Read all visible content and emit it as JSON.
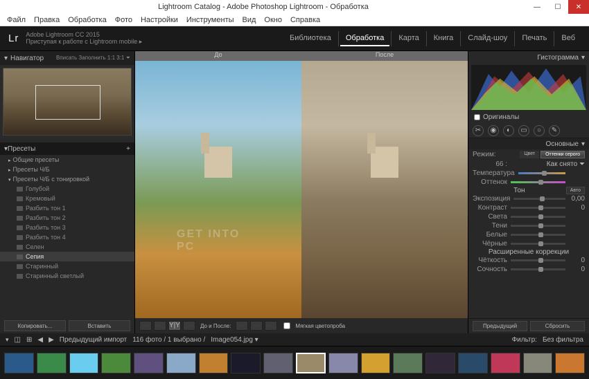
{
  "window": {
    "title": "Lightroom Catalog - Adobe Photoshop Lightroom - Обработка"
  },
  "menubar": [
    "Файл",
    "Правка",
    "Обработка",
    "Фото",
    "Настройки",
    "Инструменты",
    "Вид",
    "Окно",
    "Справка"
  ],
  "header": {
    "logo": "Lr",
    "sub1": "Adobe Lightroom CC 2015",
    "sub2": "Приступая к работе с Lightroom mobile  ▸",
    "modules": [
      "Библиотека",
      "Обработка",
      "Карта",
      "Книга",
      "Слайд-шоу",
      "Печать",
      "Веб"
    ],
    "active_module": 1
  },
  "navigator": {
    "title": "Навигатор",
    "opts": "Вписать  Заполнить  1:1  3:1  ⏷"
  },
  "presets": {
    "title": "Пресеты",
    "groups": [
      {
        "name": "Общие пресеты",
        "open": false
      },
      {
        "name": "Пресеты Ч/Б",
        "open": false
      },
      {
        "name": "Пресеты Ч/Б с тонировкой",
        "open": true,
        "items": [
          "Голубой",
          "Кремовый",
          "Разбить тон 1",
          "Разбить тон 2",
          "Разбить тон 3",
          "Разбить тон 4",
          "Селен",
          "Сепия",
          "Старинный",
          "Старинный светлый"
        ],
        "selected": 7
      }
    ],
    "copy": "Копировать...",
    "paste": "Вставить"
  },
  "compare": {
    "before": "До",
    "after": "После",
    "watermark": "GET INTO PC"
  },
  "toolbar": {
    "before_after": "До и После:",
    "softproof": "Мягкая цветопроба"
  },
  "right": {
    "histogram": "Гистограмма",
    "originals": "Оригиналы",
    "basic": "Основные",
    "mode": {
      "label": "Режим:",
      "color": "Цвет",
      "gray": "Оттенки серого"
    },
    "as_shot": "Как снято ⏷",
    "as_shot_val": "66 :",
    "wb": {
      "temp": "Температура",
      "tint": "Оттенок"
    },
    "tone": {
      "header": "Тон",
      "auto": "Авто",
      "exposure": "Экспозиция",
      "exposure_val": "0,00",
      "contrast": "Контраст",
      "contrast_val": "0"
    },
    "presence": {
      "highlights": "Света",
      "shadows": "Тени",
      "whites": "Белые",
      "blacks": "Чёрные"
    },
    "ext": {
      "header": "Расширенные коррекции",
      "clarity": "Чёткость",
      "clarity_val": "0",
      "saturation": "Сочность",
      "saturation_val": "0"
    },
    "prev": "Предыдущий",
    "reset": "Сбросить"
  },
  "filmstrip": {
    "prev_import": "Предыдущий импорт",
    "count": "116 фото / 1 выбрано /",
    "filename": "Image054.jpg ▾",
    "filter": "Фильтр:",
    "no_filter": "Без фильтра"
  },
  "thumbs": [
    "#2a5a8a",
    "#3a8a4a",
    "#6accee",
    "#4a8a3a",
    "#605080",
    "#8aa8c8",
    "#c08030",
    "#1a1a2a",
    "#606070",
    "#9a8a6a",
    "#8888aa",
    "#d4a030",
    "#5a7a5a",
    "#302838",
    "#2a4a6a",
    "#c03858",
    "#88887a",
    "#ca7830"
  ],
  "selected_thumb": 9
}
